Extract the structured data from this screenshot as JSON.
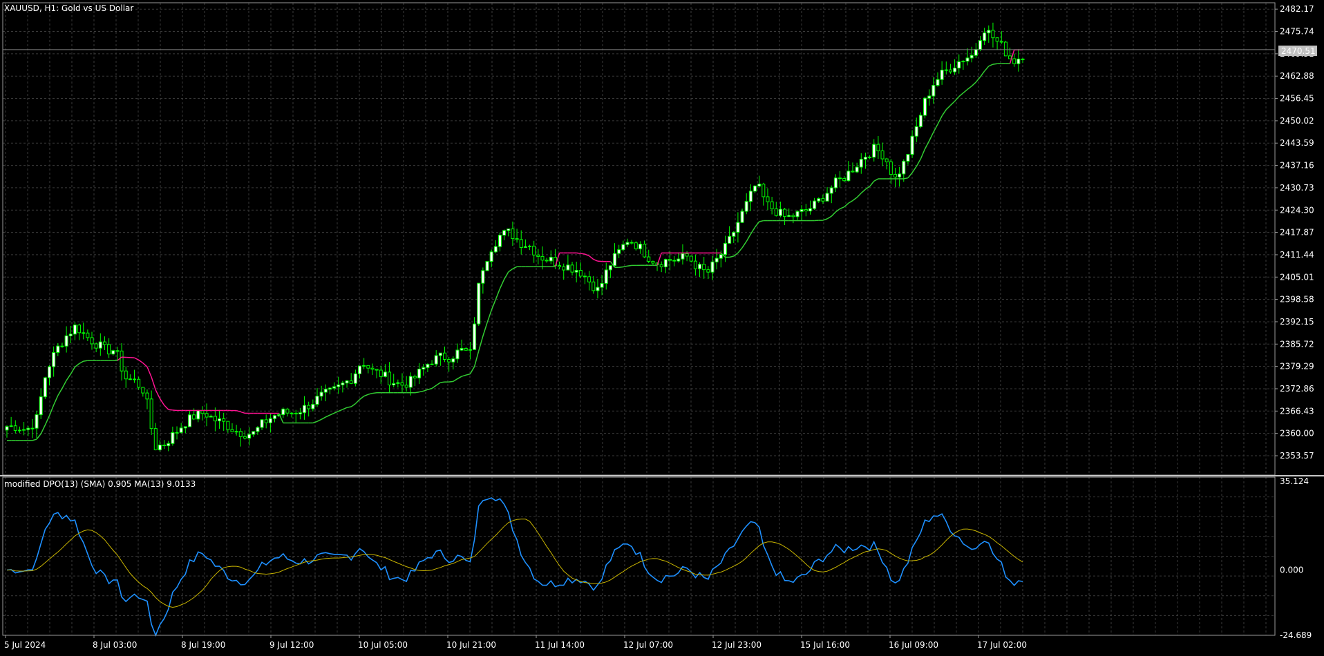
{
  "main": {
    "symbol_caption": "XAUUSD, H1:  Gold vs US Dollar",
    "current_price": "2470.51",
    "y_ticks": [
      "2482.17",
      "2475.74",
      "2469.31",
      "2462.88",
      "2456.45",
      "2450.02",
      "2443.59",
      "2437.16",
      "2430.73",
      "2424.30",
      "2417.87",
      "2411.44",
      "2405.01",
      "2398.58",
      "2392.15",
      "2385.72",
      "2379.29",
      "2372.86",
      "2366.43",
      "2360.00",
      "2353.57"
    ]
  },
  "indicator": {
    "caption": "modified DPO(13) (SMA) 0.905 MA(13) 9.0133",
    "y_ticks": [
      "35.124",
      "0.000",
      "-24.689"
    ]
  },
  "time_axis": {
    "labels": [
      "5 Jul 2024",
      "8 Jul 03:00",
      "8 Jul 19:00",
      "9 Jul 12:00",
      "10 Jul 05:00",
      "10 Jul 21:00",
      "11 Jul 14:00",
      "12 Jul 07:00",
      "12 Jul 23:00",
      "15 Jul 16:00",
      "16 Jul 09:00",
      "17 Jul 02:00"
    ]
  },
  "colors": {
    "background": "#000000",
    "grid": "#3a3a3a",
    "candle_body": "#ffffff",
    "candle_wick": "#00ff00",
    "stop_line_up": "#32cd32",
    "stop_line_down": "#ff1493",
    "dpo": "#1e90ff",
    "dpo_ma": "#c8b400",
    "axis_text": "#ffffff",
    "price_tag_bg": "#c0c0c0",
    "price_tag_text": "#ffffff"
  },
  "chart_data": [
    {
      "type": "candlestick",
      "name": "XAUUSD H1",
      "ylim": [
        2348.0,
        2484.0
      ],
      "x_anchor_prices": [
        2362,
        2362,
        2361,
        2364,
        2378,
        2384,
        2388,
        2391,
        2388,
        2386,
        2384,
        2384,
        2376,
        2375,
        2372,
        2356,
        2357,
        2360,
        2363,
        2365,
        2366,
        2364,
        2363,
        2361,
        2360,
        2360,
        2363,
        2365,
        2366,
        2366,
        2367,
        2369,
        2371,
        2372,
        2374,
        2376,
        2381,
        2378,
        2377,
        2375,
        2374,
        2375,
        2378,
        2381,
        2382,
        2382,
        2384,
        2383,
        2406,
        2413,
        2417,
        2418,
        2415,
        2414,
        2411,
        2410,
        2409,
        2408,
        2407,
        2404,
        2401,
        2408,
        2412,
        2416,
        2414,
        2411,
        2409,
        2410,
        2410,
        2411,
        2408,
        2406,
        2410,
        2414,
        2420,
        2426,
        2432,
        2426,
        2424,
        2422,
        2423,
        2424,
        2426,
        2429,
        2432,
        2434,
        2437,
        2440,
        2442,
        2440,
        2433,
        2438,
        2446,
        2455,
        2461,
        2464,
        2466,
        2468,
        2469,
        2477,
        2474,
        2471,
        2467,
        2469
      ]
    },
    {
      "type": "line",
      "name": "modified DPO(13)",
      "ylim": [
        -24.689,
        35.124
      ]
    }
  ]
}
